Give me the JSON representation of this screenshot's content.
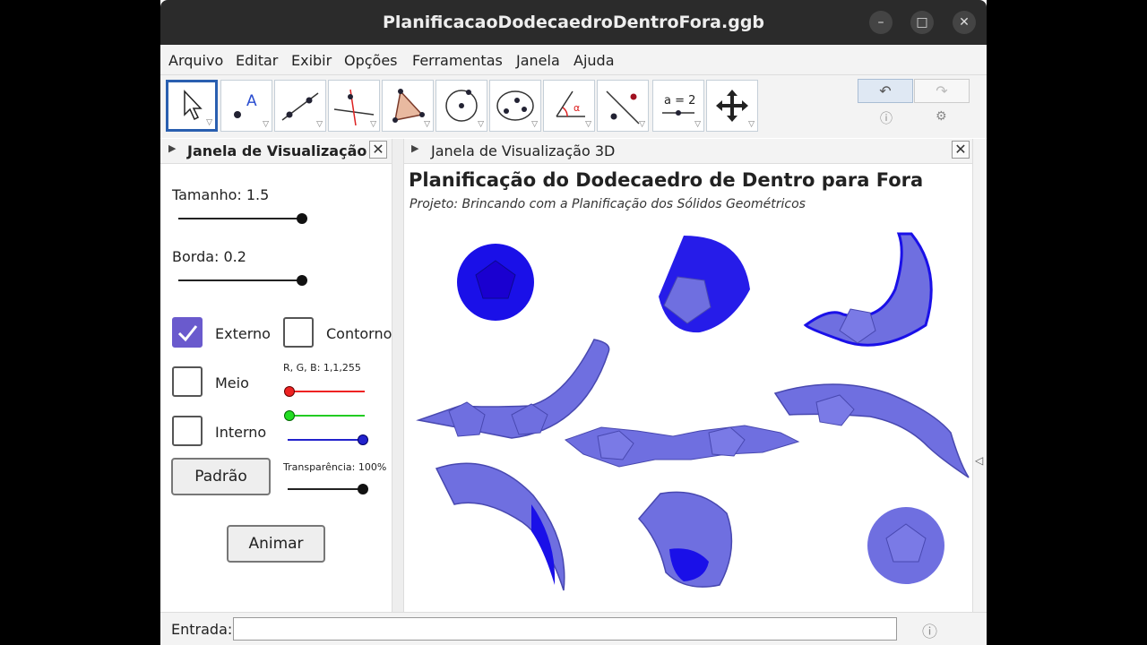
{
  "window": {
    "title": "PlanificacaoDodecaedroDentroFora.ggb"
  },
  "menu": [
    "Arquivo",
    "Editar",
    "Exibir",
    "Opções",
    "Ferramentas",
    "Janela",
    "Ajuda"
  ],
  "toolbar": {
    "tools": [
      "move-tool",
      "point-tool",
      "line-tool",
      "perpendicular-tool",
      "polygon-tool",
      "circle-tool",
      "conic-tool",
      "angle-tool",
      "reflect-tool",
      "slider-tool",
      "move-graphics-tool"
    ],
    "slider_icon_label": "a = 2",
    "angle_symbol": "α"
  },
  "left_panel": {
    "title": "Janela de Visualização",
    "tamanho_label": "Tamanho: 1.5",
    "tamanho_value": 1.5,
    "borda_label": "Borda: 0.2",
    "borda_value": 0.2,
    "checkboxes": [
      {
        "label": "Externo",
        "checked": true
      },
      {
        "label": "Contorno",
        "checked": false
      },
      {
        "label": "Meio",
        "checked": false
      },
      {
        "label": "Interno",
        "checked": false
      }
    ],
    "rgb_label": "R, G, B: 1,1,255",
    "transparency_label": "Transparência: 100%",
    "padrao_button": "Padrão",
    "animar_button": "Animar"
  },
  "graphics_panel": {
    "title": "Janela de Visualização 3D",
    "heading": "Planificação do Dodecaedro de Dentro para Fora",
    "subheading": "Projeto: Brincando com a Planificação dos Sólidos Geométricos"
  },
  "input_bar": {
    "label": "Entrada:"
  },
  "colors": {
    "solid": "#1a10e8",
    "net": "#6f6fe0",
    "accent": "#6a5acd"
  }
}
